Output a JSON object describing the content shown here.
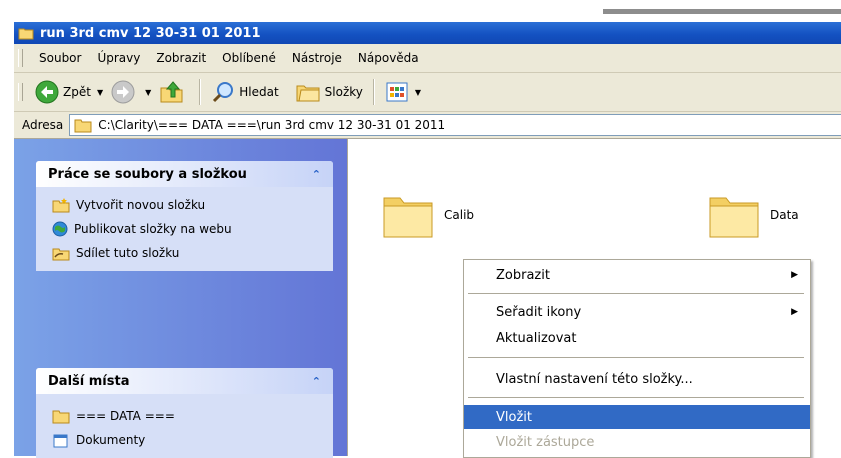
{
  "window": {
    "title": "run 3rd cmv 12 30-31 01 2011"
  },
  "menubar": {
    "items": [
      "Soubor",
      "Úpravy",
      "Zobrazit",
      "Oblíbené",
      "Nástroje",
      "Nápověda"
    ]
  },
  "toolbar": {
    "back_label": "Zpět",
    "search_label": "Hledat",
    "folders_label": "Složky"
  },
  "address": {
    "label": "Adresa",
    "value": "C:\\Clarity\\=== DATA ===\\run 3rd cmv 12 30-31 01 2011"
  },
  "tasks_panel": {
    "title": "Práce se soubory a složkou",
    "collapse_glyph": "⌃",
    "items": [
      "Vytvořit novou složku",
      "Publikovat složky na webu",
      "Sdílet tuto složku"
    ]
  },
  "places_panel": {
    "title": "Další místa",
    "collapse_glyph": "⌃",
    "items": [
      "=== DATA ===",
      "Dokumenty"
    ]
  },
  "folders": [
    {
      "name": "Calib"
    },
    {
      "name": "Data"
    }
  ],
  "context_menu": {
    "items": [
      {
        "label": "Zobrazit",
        "submenu": true
      },
      {
        "label": "Seřadit ikony",
        "submenu": true
      },
      {
        "label": "Aktualizovat"
      },
      {
        "label": "Vlastní nastavení této složky..."
      },
      {
        "label": "Vložit",
        "selected": true
      },
      {
        "label": "Vložit zástupce",
        "disabled": true
      }
    ]
  },
  "colors": {
    "titlebar": "#1452c2",
    "selection": "#316ac5",
    "panel_bg": "#d6dff7",
    "task_text": "#215dc6"
  }
}
